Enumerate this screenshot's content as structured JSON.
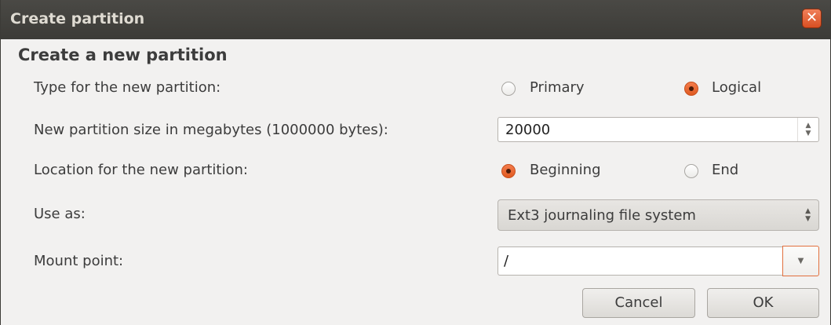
{
  "window": {
    "title": "Create partition",
    "close_glyph": "✕"
  },
  "heading": "Create a new partition",
  "type_row": {
    "label": "Type for the new partition:",
    "options": [
      {
        "label": "Primary",
        "checked": false
      },
      {
        "label": "Logical",
        "checked": true
      }
    ]
  },
  "size_row": {
    "label": "New partition size in megabytes (1000000 bytes):",
    "value": "20000"
  },
  "location_row": {
    "label": "Location for the new partition:",
    "options": [
      {
        "label": "Beginning",
        "checked": true
      },
      {
        "label": "End",
        "checked": false
      }
    ]
  },
  "use_as_row": {
    "label": "Use as:",
    "selected": "Ext3 journaling file system"
  },
  "mount_row": {
    "label": "Mount point:",
    "value": "/"
  },
  "buttons": {
    "cancel": "Cancel",
    "ok": "OK"
  },
  "colors": {
    "titlebar": "#3c3b37",
    "accent": "#e05a20",
    "background": "#f2f1f0"
  },
  "icons": {
    "close": "close-icon",
    "spin_up": "chevron-up-icon",
    "spin_down": "chevron-down-icon",
    "combo": "updown-arrows-icon",
    "mount_dropdown": "chevron-down-icon"
  }
}
